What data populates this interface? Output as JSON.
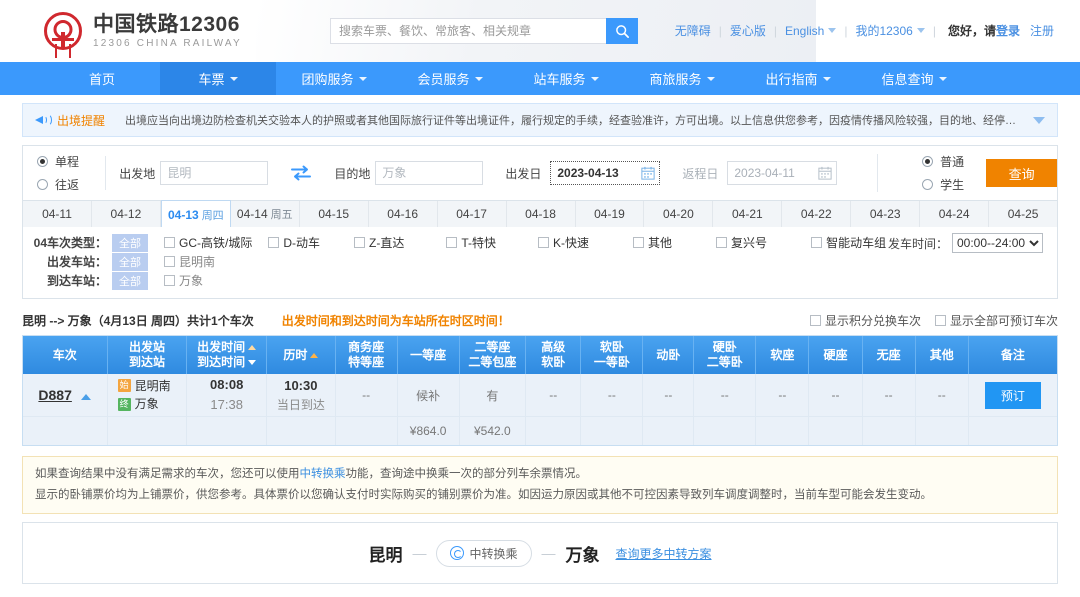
{
  "header": {
    "brand_cn": "中国铁路12306",
    "brand_en": "12306 CHINA RAILWAY",
    "search_placeholder": "搜索车票、餐饮、常旅客、相关规章",
    "search_value": "",
    "links": [
      {
        "label": "无障碍",
        "caret": false
      },
      {
        "label": "爱心版",
        "caret": false
      },
      {
        "label": "English",
        "caret": true
      },
      {
        "label": "我的12306",
        "caret": true
      }
    ],
    "greeting": "您好，请",
    "login_label": "登录",
    "register_label": "注册"
  },
  "nav": {
    "items": [
      {
        "label": "首页",
        "caret": false,
        "active": false
      },
      {
        "label": "车票",
        "caret": true,
        "active": true
      },
      {
        "label": "团购服务",
        "caret": true,
        "active": false
      },
      {
        "label": "会员服务",
        "caret": true,
        "active": false
      },
      {
        "label": "站车服务",
        "caret": true,
        "active": false
      },
      {
        "label": "商旅服务",
        "caret": true,
        "active": false
      },
      {
        "label": "出行指南",
        "caret": true,
        "active": false
      },
      {
        "label": "信息查询",
        "caret": true,
        "active": false
      }
    ]
  },
  "notice": {
    "tag": "出境提醒",
    "text": "出境应当向出境边防检查机关交验本人的护照或者其他国际旅行证件等出境证件，履行规定的手续，经查验准许，方可出境。以上信息供您参考，因疫情传播风险较强，目的地、经停（转）地的…"
  },
  "query": {
    "trip_types": [
      {
        "label": "单程",
        "selected": true
      },
      {
        "label": "往返",
        "selected": false
      }
    ],
    "from_label": "出发地",
    "from_value": "昆明",
    "from_placeholder": "昆明",
    "to_label": "目的地",
    "to_value": "万象",
    "to_placeholder": "万象",
    "depart_label": "出发日",
    "depart_value": "2023-04-13",
    "return_label": "返程日",
    "return_value": "2023-04-11",
    "passenger_types": [
      {
        "label": "普通",
        "selected": true
      },
      {
        "label": "学生",
        "selected": false
      }
    ],
    "submit_label": "查询"
  },
  "date_tabs": [
    {
      "date": "04-11",
      "dow": "",
      "active": false
    },
    {
      "date": "04-12",
      "dow": "",
      "active": false
    },
    {
      "date": "04-13",
      "dow": "周四",
      "active": true
    },
    {
      "date": "04-14",
      "dow": "周五",
      "active": false
    },
    {
      "date": "04-15",
      "dow": "",
      "active": false
    },
    {
      "date": "04-16",
      "dow": "",
      "active": false
    },
    {
      "date": "04-17",
      "dow": "",
      "active": false
    },
    {
      "date": "04-18",
      "dow": "",
      "active": false
    },
    {
      "date": "04-19",
      "dow": "",
      "active": false
    },
    {
      "date": "04-20",
      "dow": "",
      "active": false
    },
    {
      "date": "04-21",
      "dow": "",
      "active": false
    },
    {
      "date": "04-22",
      "dow": "",
      "active": false
    },
    {
      "date": "04-23",
      "dow": "",
      "active": false
    },
    {
      "date": "04-24",
      "dow": "",
      "active": false
    },
    {
      "date": "04-25",
      "dow": "",
      "active": false
    }
  ],
  "filters": {
    "all_label": "全部",
    "train_type_label": "04车次类型：",
    "train_types": [
      "GC-高铁/城际",
      "D-动车",
      "Z-直达",
      "T-特快",
      "K-快速",
      "其他",
      "复兴号",
      "智能动车组"
    ],
    "from_station_label": "出发车站：",
    "from_stations": [
      "昆明南"
    ],
    "to_station_label": "到达车站：",
    "to_stations": [
      "万象"
    ],
    "depart_time_label": "发车时间：",
    "depart_time_value": "00:00--24:00"
  },
  "summary": {
    "route": "昆明 --> 万象（4月13日 周四）共计1个车次",
    "warning": "出发时间和到达时间为车站所在时区时间！",
    "toggles": [
      "显示积分兑换车次",
      "显示全部可预订车次"
    ]
  },
  "table": {
    "columns": [
      {
        "l1": "车次",
        "l2": "",
        "sort": ""
      },
      {
        "l1": "出发站",
        "l2": "到达站",
        "sort": ""
      },
      {
        "l1": "出发时间",
        "l2": "到达时间",
        "sort": "both"
      },
      {
        "l1": "历时",
        "l2": "",
        "sort": "up"
      },
      {
        "l1": "商务座",
        "l2": "特等座",
        "sort": ""
      },
      {
        "l1": "一等座",
        "l2": "",
        "sort": ""
      },
      {
        "l1": "二等座",
        "l2": "二等包座",
        "sort": ""
      },
      {
        "l1": "高级",
        "l2": "软卧",
        "sort": ""
      },
      {
        "l1": "软卧",
        "l2": "一等卧",
        "sort": ""
      },
      {
        "l1": "动卧",
        "l2": "",
        "sort": ""
      },
      {
        "l1": "硬卧",
        "l2": "二等卧",
        "sort": ""
      },
      {
        "l1": "软座",
        "l2": "",
        "sort": ""
      },
      {
        "l1": "硬座",
        "l2": "",
        "sort": ""
      },
      {
        "l1": "无座",
        "l2": "",
        "sort": ""
      },
      {
        "l1": "其他",
        "l2": "",
        "sort": ""
      },
      {
        "l1": "备注",
        "l2": "",
        "sort": ""
      }
    ],
    "rows": [
      {
        "train_no": "D887",
        "from_station": "昆明南",
        "to_station": "万象",
        "depart_time": "08:08",
        "arrive_time": "17:38",
        "duration": "10:30",
        "arrive_day": "当日到达",
        "seats": [
          "--",
          "候补",
          "有",
          "--",
          "--",
          "--",
          "--",
          "--",
          "--",
          "--",
          "--"
        ],
        "prices": [
          "",
          "¥864.0",
          "¥542.0",
          "",
          "",
          "",
          "",
          "",
          "",
          "",
          ""
        ],
        "action_label": "预订"
      }
    ]
  },
  "tips": {
    "line1_pre": "如果查询结果中没有满足需求的车次，您还可以使用",
    "line1_link": "中转换乘",
    "line1_post": "功能，查询途中换乘一次的部分列车余票情况。",
    "line2": "显示的卧铺票价均为上铺票价，供您参考。具体票价以您确认支付时实际购买的铺别票价为准。如因运力原因或其他不可控因素导致列车调度调整时，当前车型可能会发生变动。"
  },
  "transfer": {
    "from_city": "昆明",
    "to_city": "万象",
    "pill_label": "中转换乘",
    "more_link": "查询更多中转方案"
  }
}
